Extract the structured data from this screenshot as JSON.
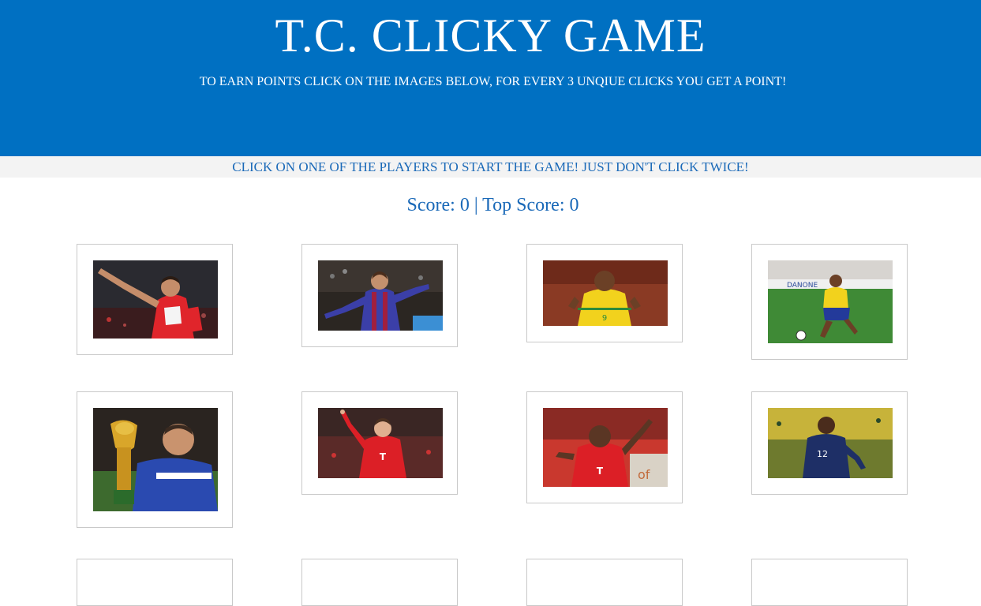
{
  "header": {
    "title": "T.C. CLICKY GAME",
    "subtitle": "TO EARN POINTS CLICK ON THE IMAGES BELOW, FOR EVERY 3 UNQIUE CLICKS YOU GET A POINT!"
  },
  "instruction": "CLICK ON ONE OF THE PLAYERS TO START THE GAME! JUST DON'T CLICK TWICE!",
  "score": {
    "text": "Score: 0 | Top Score: 0",
    "score": 0,
    "top_score": 0
  },
  "colors": {
    "header_bg": "#0070c2",
    "accent_text": "#1a69b8",
    "instruction_bg": "#f3f3f3"
  },
  "players": [
    {
      "name": "player-card-arsenal",
      "icon": "player-photo",
      "kit": "#e0252b"
    },
    {
      "name": "player-card-barcelona",
      "icon": "player-photo",
      "kit": "#3b3fa8"
    },
    {
      "name": "player-card-brazil-1",
      "icon": "player-photo",
      "kit": "#f2d21d"
    },
    {
      "name": "player-card-brazil-2",
      "icon": "player-photo",
      "kit": "#f2d21d"
    },
    {
      "name": "player-card-france-trophy",
      "icon": "player-photo",
      "kit": "#2a4ab0"
    },
    {
      "name": "player-card-bayern-1",
      "icon": "player-photo",
      "kit": "#dc1f26"
    },
    {
      "name": "player-card-bayern-2",
      "icon": "player-photo",
      "kit": "#dc1f26"
    },
    {
      "name": "player-card-france",
      "icon": "player-photo",
      "kit": "#1e2f66"
    },
    {
      "name": "player-card-row3-1",
      "icon": "player-photo",
      "kit": "#888888"
    },
    {
      "name": "player-card-row3-2",
      "icon": "player-photo",
      "kit": "#888888"
    },
    {
      "name": "player-card-row3-3",
      "icon": "player-photo",
      "kit": "#888888"
    },
    {
      "name": "player-card-row3-4",
      "icon": "player-photo",
      "kit": "#888888"
    }
  ]
}
